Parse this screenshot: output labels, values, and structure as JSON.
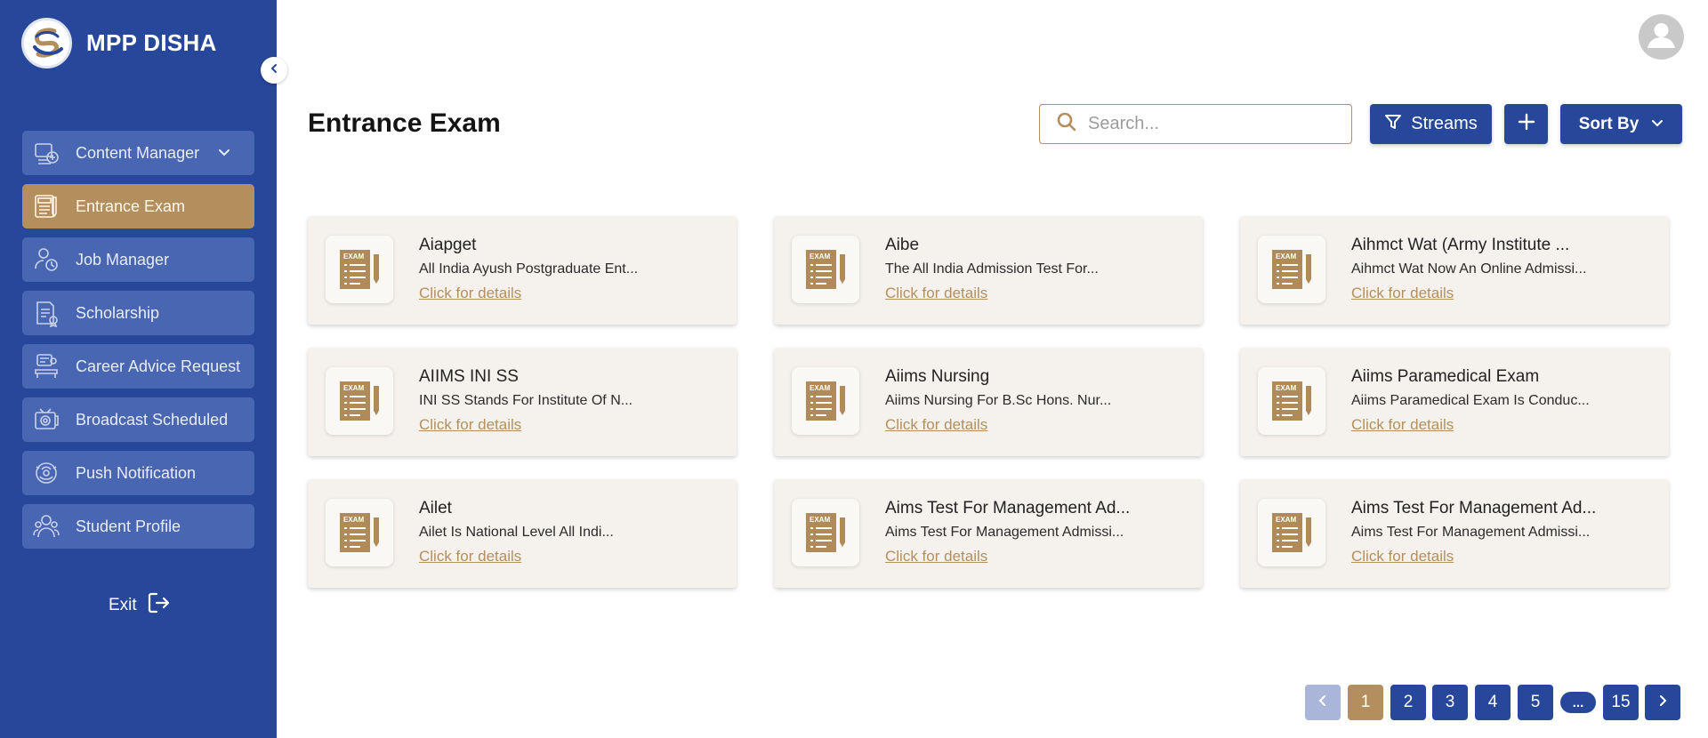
{
  "brand": {
    "name": "MPP DISHA"
  },
  "sidebar": {
    "items": [
      {
        "label": "Content Manager",
        "icon": "content-manager-icon",
        "has_dropdown": true,
        "active": false
      },
      {
        "label": "Entrance Exam",
        "icon": "entrance-exam-icon",
        "active": true
      },
      {
        "label": "Job Manager",
        "icon": "job-manager-icon",
        "active": false
      },
      {
        "label": "Scholarship",
        "icon": "scholarship-icon",
        "active": false
      },
      {
        "label": "Career Advice Request",
        "icon": "career-advice-icon",
        "active": false
      },
      {
        "label": "Broadcast Scheduled",
        "icon": "broadcast-icon",
        "active": false
      },
      {
        "label": "Push Notification",
        "icon": "push-notification-icon",
        "active": false
      },
      {
        "label": "Student Profile",
        "icon": "student-profile-icon",
        "active": false
      }
    ],
    "exit_label": "Exit"
  },
  "header": {
    "title": "Entrance Exam",
    "search_placeholder": "Search...",
    "streams_label": "Streams",
    "add_label": "+",
    "sort_label": "Sort By"
  },
  "cards": [
    {
      "title": "Aiapget",
      "description": "All India Ayush Postgraduate Ent...",
      "link": "Click for details"
    },
    {
      "title": "Aibe",
      "description": "The All India Admission Test For...",
      "link": "Click for details"
    },
    {
      "title": "Aihmct Wat (Army Institute ...",
      "description": "Aihmct Wat Now An Online Admissi...",
      "link": "Click for details"
    },
    {
      "title": "AIIMS INI SS",
      "description": "INI SS Stands For Institute Of N...",
      "link": "Click for details"
    },
    {
      "title": "Aiims Nursing",
      "description": "Aiims Nursing For B.Sc Hons. Nur...",
      "link": "Click for details"
    },
    {
      "title": "Aiims Paramedical Exam",
      "description": "Aiims Paramedical Exam Is Conduc...",
      "link": "Click for details"
    },
    {
      "title": "Ailet",
      "description": "Ailet Is National Level All Indi...",
      "link": "Click for details"
    },
    {
      "title": "Aims Test For Management Ad...",
      "description": "Aims Test For Management Admissi...",
      "link": "Click for details"
    },
    {
      "title": "Aims Test For Management Ad...",
      "description": "Aims Test For Management Admissi...",
      "link": "Click for details"
    }
  ],
  "card_thumb_label": "EXAM",
  "pagination": {
    "prev": "‹",
    "pages": [
      "1",
      "2",
      "3",
      "4",
      "5"
    ],
    "ellipsis": "...",
    "last": "15",
    "next": "›",
    "current": "1"
  },
  "colors": {
    "sidebar_bg": "#27479a",
    "nav_item_bg": "#4866b1",
    "accent_gold": "#b48f5e",
    "card_bg": "#f5f2ed",
    "primary_button": "#27479a"
  }
}
